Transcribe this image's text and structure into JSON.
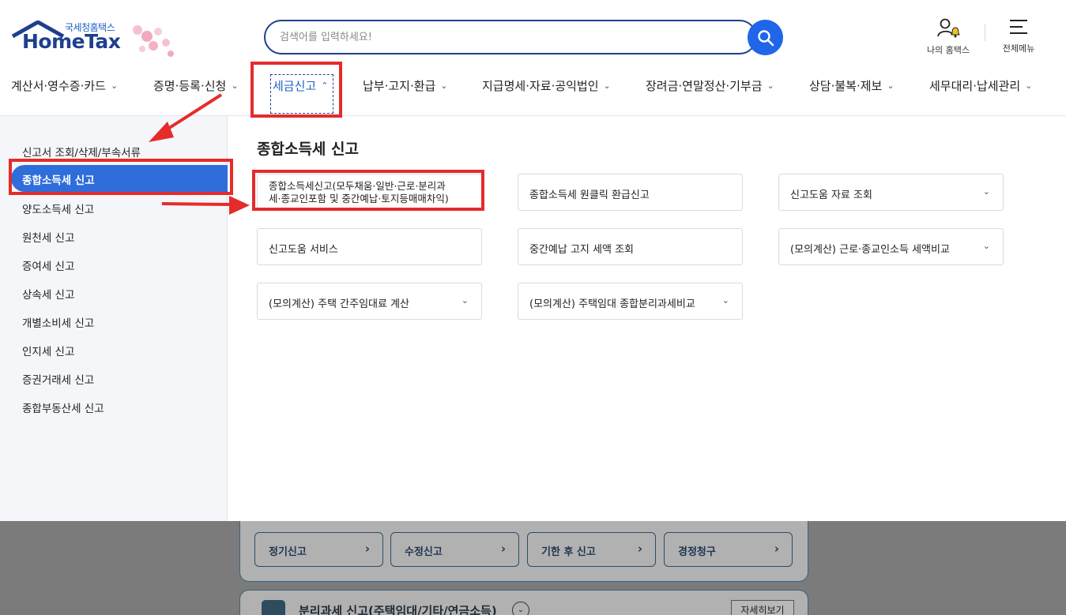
{
  "header": {
    "logo": {
      "subtitle": "국세청홈택스",
      "title": "HomeTax"
    },
    "search": {
      "placeholder": "검색어를 입력하세요!"
    },
    "util": {
      "my_label": "나의 홈택스",
      "menu_label": "전체메뉴"
    }
  },
  "gnb": [
    {
      "label": "계산서·영수증·카드"
    },
    {
      "label": "증명·등록·신청"
    },
    {
      "label": "세금신고"
    },
    {
      "label": "납부·고지·환급"
    },
    {
      "label": "지급명세·자료·공익법인"
    },
    {
      "label": "장려금·연말정산·기부금"
    },
    {
      "label": "상담·불복·제보"
    },
    {
      "label": "세무대리·납세관리"
    }
  ],
  "lnb": {
    "items": [
      {
        "label": "신고서 조회/삭제/부속서류"
      },
      {
        "label": "종합소득세 신고"
      },
      {
        "label": "양도소득세 신고"
      },
      {
        "label": "원천세 신고"
      },
      {
        "label": "증여세 신고"
      },
      {
        "label": "상속세 신고"
      },
      {
        "label": "개별소비세 신고"
      },
      {
        "label": "인지세 신고"
      },
      {
        "label": "증권거래세 신고"
      },
      {
        "label": "종합부동산세 신고"
      }
    ]
  },
  "content": {
    "title": "종합소득세 신고",
    "cards": [
      {
        "label_line1": "종합소득세신고(모두채움·일반·근로·분리과",
        "label_line2": "세·종교인포함 및 중간예납·토지등매매차익)"
      },
      {
        "label": "종합소득세 원클릭 환급신고"
      },
      {
        "label": "신고도움 자료 조회"
      },
      {
        "label": "신고도움 서비스"
      },
      {
        "label": "중간예납 고지 세액 조회"
      },
      {
        "label": "(모의계산) 근로·종교인소득 세액비교"
      },
      {
        "label": "(모의계산) 주택 간주임대료 계산"
      },
      {
        "label": "(모의계산) 주택임대 종합분리과세비교"
      }
    ]
  },
  "background_panel": {
    "buttons": [
      {
        "label": "정기신고"
      },
      {
        "label": "수정신고"
      },
      {
        "label": "기한 후 신고"
      },
      {
        "label": "경정청구"
      }
    ],
    "section_title": "분리과세 신고(주택임대/기타/연금소득)",
    "detail_button": "자세히보기"
  },
  "colors": {
    "accent": "#2166e8",
    "brand_navy": "#1e3f8f",
    "annotation_red": "#e52b2b"
  }
}
